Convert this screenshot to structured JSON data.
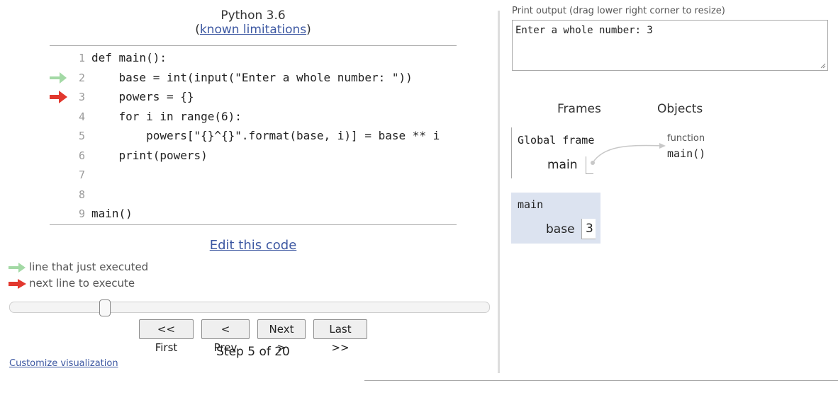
{
  "header": {
    "language": "Python 3.6",
    "limitations_open": "(",
    "limitations_link": "known limitations",
    "limitations_close": ")"
  },
  "code": {
    "lines": [
      {
        "num": "1",
        "text": "def main():",
        "arrow": "none"
      },
      {
        "num": "2",
        "text": "    base = int(input(\"Enter a whole number: \"))",
        "arrow": "just-executed"
      },
      {
        "num": "3",
        "text": "    powers = {}",
        "arrow": "next"
      },
      {
        "num": "4",
        "text": "    for i in range(6):",
        "arrow": "none"
      },
      {
        "num": "5",
        "text": "        powers[\"{}^{}\".format(base, i)] = base ** i",
        "arrow": "none"
      },
      {
        "num": "6",
        "text": "    print(powers)",
        "arrow": "none"
      },
      {
        "num": "7",
        "text": "",
        "arrow": "none"
      },
      {
        "num": "8",
        "text": "",
        "arrow": "none"
      },
      {
        "num": "9",
        "text": "main()",
        "arrow": "none"
      }
    ]
  },
  "edit_code": "Edit this code",
  "legend": {
    "just_executed": "line that just executed",
    "next_line": "next line to execute"
  },
  "slider": {
    "position": 5,
    "max": 20
  },
  "nav": {
    "first": "<< First",
    "prev": "< Prev",
    "next": "Next >",
    "last": "Last >>"
  },
  "step_text": "Step 5 of 20",
  "customize": "Customize visualization",
  "print_output": {
    "label": "Print output (drag lower right corner to resize)",
    "content": "Enter a whole number: 3"
  },
  "viz": {
    "frames_header": "Frames",
    "objects_header": "Objects",
    "global_frame": {
      "title": "Global frame",
      "var_name": "main"
    },
    "function_object": {
      "type_label": "function",
      "name": "main()"
    },
    "main_frame": {
      "title": "main",
      "var_name": "base",
      "var_value": "3"
    }
  },
  "colors": {
    "just_executed_arrow": "#a3d9a5",
    "next_arrow": "#e2382e",
    "link": "#3D58A2",
    "frame_bg": "#dce3f0"
  }
}
